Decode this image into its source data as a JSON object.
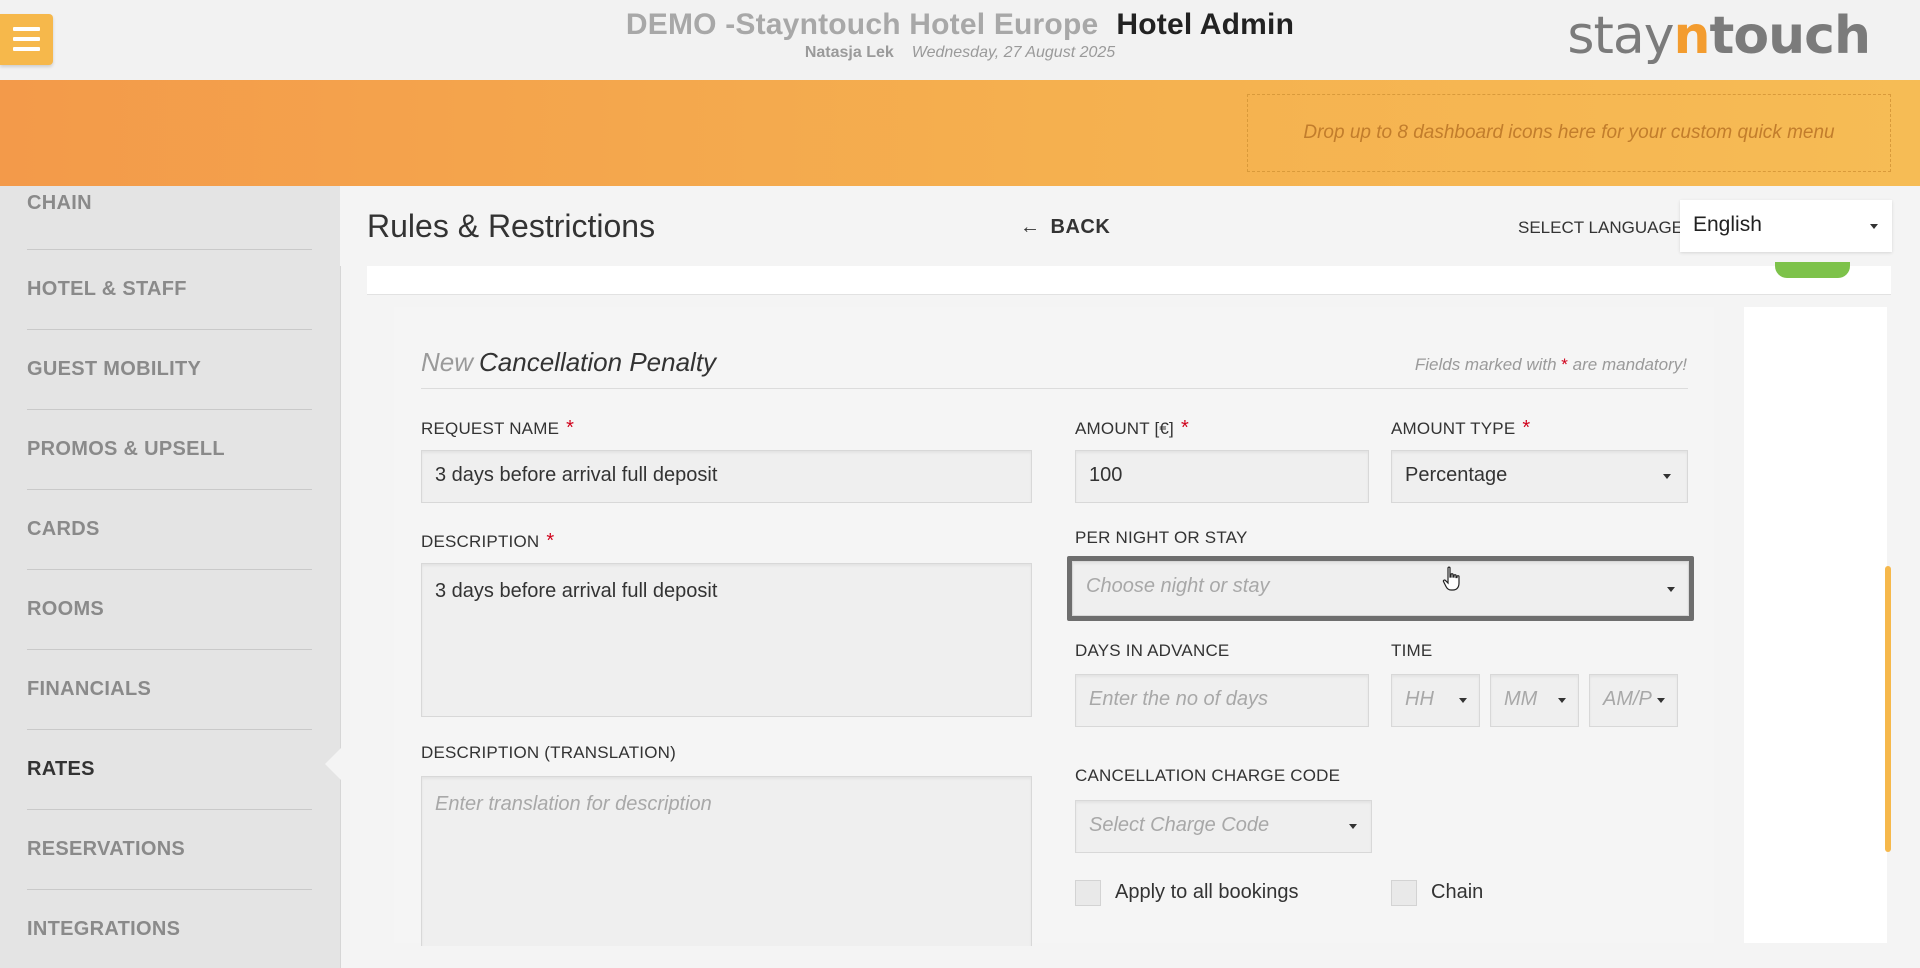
{
  "header": {
    "hotel_name": "DEMO -Stayntouch Hotel Europe",
    "app_name": "Hotel Admin",
    "user_name": "Natasja Lek",
    "date": "Wednesday, 27 August 2025",
    "logo": {
      "part1": "stay",
      "part2": "n",
      "part3": "touch"
    }
  },
  "quick_menu": {
    "placeholder": "Drop up to 8 dashboard icons here for your custom quick menu"
  },
  "sidebar": {
    "items": [
      {
        "label": "CHAIN"
      },
      {
        "label": "HOTEL & STAFF"
      },
      {
        "label": "GUEST MOBILITY"
      },
      {
        "label": "PROMOS & UPSELL"
      },
      {
        "label": "CARDS"
      },
      {
        "label": "ROOMS"
      },
      {
        "label": "FINANCIALS"
      },
      {
        "label": "RATES",
        "active": true
      },
      {
        "label": "RESERVATIONS"
      },
      {
        "label": "INTEGRATIONS"
      }
    ]
  },
  "page": {
    "title": "Rules & Restrictions",
    "back_label": "BACK",
    "back_arrow": "←",
    "language_label": "SELECT LANGUAGE",
    "language_value": "English"
  },
  "form": {
    "title_prefix": "New",
    "title": "Cancellation Penalty",
    "mandatory_prefix": "Fields marked with",
    "mandatory_star": "*",
    "mandatory_suffix": "are mandatory!",
    "request_name": {
      "label": "REQUEST NAME",
      "value": "3 days before arrival full deposit"
    },
    "description": {
      "label": "DESCRIPTION",
      "value": "3 days before arrival full deposit"
    },
    "description_translation": {
      "label": "DESCRIPTION (TRANSLATION)",
      "placeholder": "Enter translation for description"
    },
    "amount": {
      "label": "AMOUNT [€]",
      "value": "100"
    },
    "amount_type": {
      "label": "AMOUNT TYPE",
      "value": "Percentage"
    },
    "per_night_or_stay": {
      "label": "PER NIGHT OR STAY",
      "placeholder": "Choose night or stay"
    },
    "days_in_advance": {
      "label": "DAYS IN ADVANCE",
      "placeholder": "Enter the no of days"
    },
    "time": {
      "label": "TIME",
      "hh": "HH",
      "mm": "MM",
      "ampm": "AM/P"
    },
    "charge_code": {
      "label": "CANCELLATION CHARGE CODE",
      "placeholder": "Select Charge Code"
    },
    "apply_all": {
      "label": "Apply to all bookings",
      "checked": false
    },
    "chain": {
      "label": "Chain",
      "checked": false
    },
    "required_mark": "*"
  },
  "colors": {
    "accent_orange": "#f39a4a",
    "menu_button": "#f6b84b",
    "required_red": "#d0021b",
    "toggle_green": "#7dc24a"
  }
}
